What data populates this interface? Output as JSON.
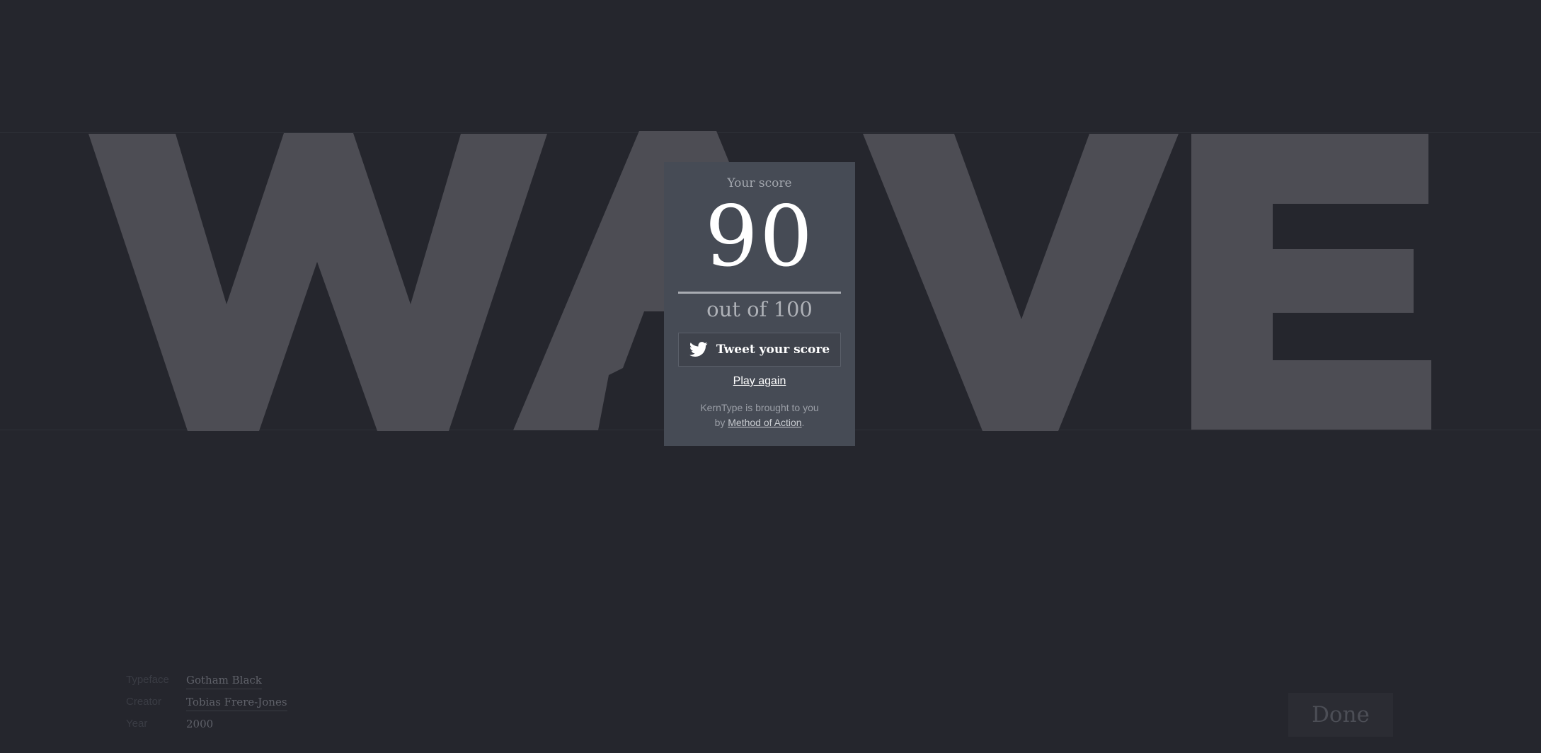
{
  "word": {
    "letters": [
      "W",
      "A",
      "V",
      "E"
    ],
    "glyph_color": "#4d4d54",
    "background": "#25262d"
  },
  "result": {
    "heading": "Your score",
    "score": "90",
    "out_of": "out of 100",
    "tweet_label": "Tweet your score",
    "tweet_icon": "twitter-bird-icon",
    "play_again": "Play again",
    "credit_prefix": "KernType is brought to you",
    "credit_by": "by ",
    "credit_link": "Method of Action",
    "credit_suffix": "."
  },
  "meta": {
    "typeface_label": "Typeface",
    "typeface_value": "Gotham Black",
    "creator_label": "Creator",
    "creator_value": "Tobias Frere-Jones",
    "year_label": "Year",
    "year_value": "2000"
  },
  "done_label": "Done",
  "colors": {
    "modal_bg": "#464b55",
    "score_text": "#ffffff"
  }
}
